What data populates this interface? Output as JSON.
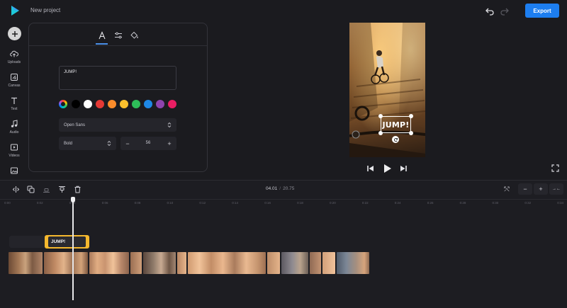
{
  "header": {
    "project_title": "New project",
    "export_label": "Export",
    "logo_icon": "play-logo-icon",
    "undo_icon": "undo-icon",
    "redo_icon": "redo-icon"
  },
  "sidebar": {
    "add_icon": "plus-icon",
    "items": [
      {
        "label": "Uploads",
        "icon": "upload-cloud-icon"
      },
      {
        "label": "Canvas",
        "icon": "canvas-icon"
      },
      {
        "label": "Text",
        "icon": "text-icon"
      },
      {
        "label": "Audio",
        "icon": "music-note-icon"
      },
      {
        "label": "Videos",
        "icon": "video-icon"
      },
      {
        "label": "",
        "icon": "image-icon"
      }
    ]
  },
  "text_panel": {
    "tabs": [
      {
        "name": "text",
        "icon": "letter-a-icon",
        "selected": true
      },
      {
        "name": "adjust",
        "icon": "sliders-icon",
        "selected": false
      },
      {
        "name": "fill",
        "icon": "paint-bucket-icon",
        "selected": false
      }
    ],
    "text_value": "JUMP!",
    "colors": [
      "#000000",
      "#ffffff",
      "#e53935",
      "#fb8c2b",
      "#fbc02d",
      "#2ebd59",
      "#1e88e5",
      "#8e44ad",
      "#e91e63"
    ],
    "font_family": "Open Sans",
    "font_weight": "Bold",
    "font_size": "56"
  },
  "preview": {
    "overlay_text": "JUMP!",
    "controls": [
      "skip-back-icon",
      "play-icon",
      "skip-forward-icon"
    ],
    "fullscreen_icon": "fullscreen-icon"
  },
  "timeline": {
    "current_time": "04.01",
    "separator": "/",
    "total_time": "20.75",
    "tools": [
      "split-icon",
      "duplicate-icon",
      "align-bottom-icon",
      "align-top-icon",
      "trash-icon"
    ],
    "zoom_controls": {
      "fit": "⤲",
      "minus": "−",
      "plus": "+",
      "expand": "→←"
    },
    "ruler_labels": [
      "0:00",
      "0:02",
      "0:04",
      "0:06",
      "0:08",
      "0:10",
      "0:12",
      "0:14",
      "0:16",
      "0:18",
      "0:20",
      "0:22",
      "0:24",
      "0:26",
      "0:28",
      "0:30",
      "0:32",
      "0:34"
    ],
    "text_clip_label": "JUMP!",
    "accent_color": "#f5b82e"
  }
}
